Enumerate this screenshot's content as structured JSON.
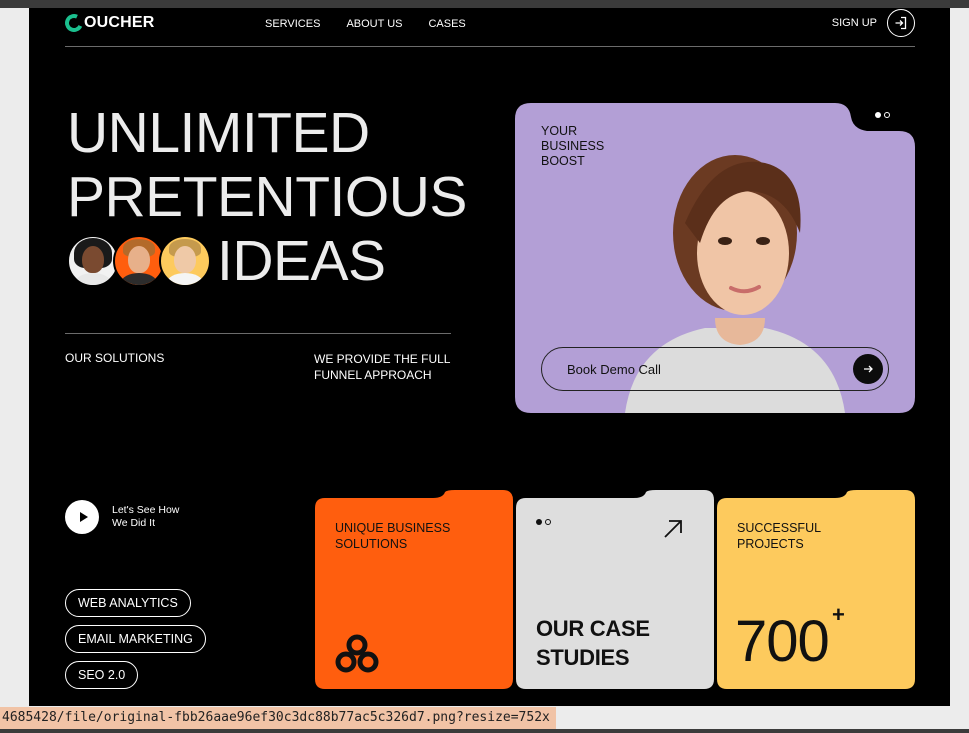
{
  "brand": {
    "name": "OUCHER",
    "accent": "#1bbf8e"
  },
  "nav": {
    "items": [
      "SERVICES",
      "ABOUT US",
      "CASES"
    ]
  },
  "header": {
    "signup_label": "SIGN UP"
  },
  "hero": {
    "line1": "UNLIMITED",
    "line2": "PRETENTIOUS",
    "line3": "IDEAS",
    "solutions_label": "OUR SOLUTIONS",
    "funnel_text": "WE PROVIDE THE FULL FUNNEL APPROACH"
  },
  "hero_card": {
    "kicker": "YOUR BUSINESS BOOST",
    "demo_label": "Book Demo Call",
    "background": "#b39fd6",
    "carousel_active": 1,
    "carousel_total": 2
  },
  "play": {
    "text": "Let's See How We Did It"
  },
  "tags": [
    "WEB ANALYTICS",
    "EMAIL MARKETING",
    "SEO 2.0"
  ],
  "cards": {
    "solutions": {
      "title": "UNIQUE BUSINESS SOLUTIONS",
      "color": "#ff5e0e"
    },
    "case_studies": {
      "title": "OUR CASE STUDIES",
      "color": "#dedede"
    },
    "projects": {
      "title": "SUCCESSFUL PROJECTS",
      "value": "700",
      "suffix": "+",
      "color": "#fdca5d"
    }
  },
  "status_url": "4685428/file/original-fbb26aae96ef30c3dc88b77ac5c326d7.png?resize=752x"
}
